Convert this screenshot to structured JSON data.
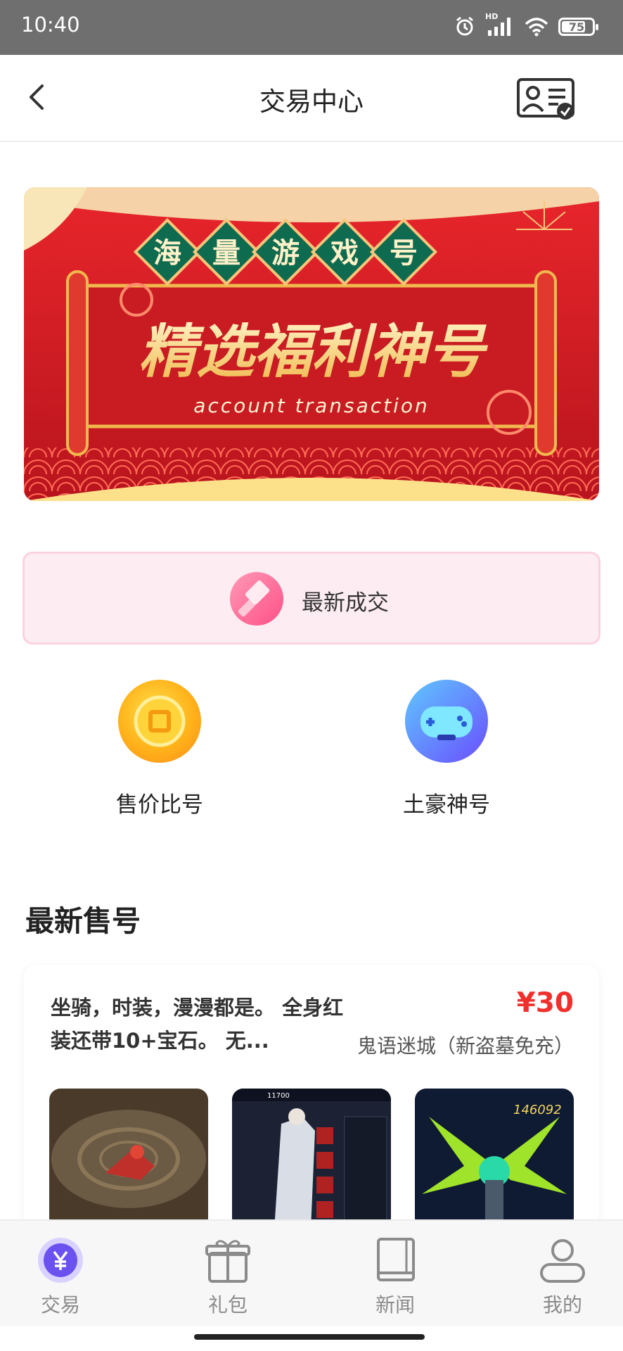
{
  "status_bar": {
    "time": "10:40",
    "battery": "75",
    "network_label": "HD",
    "icons": [
      "alarm-icon",
      "signal-icon",
      "wifi-icon",
      "battery-icon"
    ]
  },
  "header": {
    "title": "交易中心",
    "back_icon": "chevron-left-icon",
    "right_icon": "id-card-check-icon"
  },
  "banner": {
    "badges": [
      "海",
      "量",
      "游",
      "戏",
      "号"
    ],
    "headline": "精选福利神号",
    "subtitle": "account transaction"
  },
  "latest_deals": {
    "label": "最新成交",
    "icon": "hammer-icon"
  },
  "categories": [
    {
      "label": "售价比号",
      "icon": "coin-icon"
    },
    {
      "label": "土豪神号",
      "icon": "gamepad-icon"
    }
  ],
  "section": {
    "title": "最新售号"
  },
  "listing": {
    "description": "坐骑，时装，漫漫都是。 全身红装还带10+宝石。 无...",
    "price": "¥30",
    "game": "鬼语迷城（新盗墓免充）",
    "thumbs": [
      {
        "caption": ""
      },
      {
        "caption": "11700"
      },
      {
        "caption": "146092"
      }
    ]
  },
  "bottom_nav": [
    {
      "label": "交易",
      "icon": "yuan-icon",
      "active": true
    },
    {
      "label": "礼包",
      "icon": "gift-icon"
    },
    {
      "label": "新闻",
      "icon": "book-icon"
    },
    {
      "label": "我的",
      "icon": "user-icon"
    }
  ],
  "colors": {
    "price_red": "#f0302c",
    "banner_red": "#d21d24",
    "accent_purple": "#7b61ff",
    "deals_bg": "#fdecf1"
  }
}
